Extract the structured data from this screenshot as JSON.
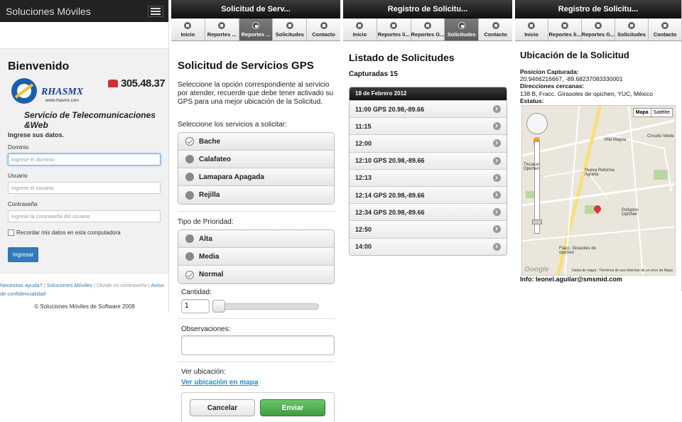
{
  "p1": {
    "brand": "Soluciones Móviles",
    "welcome": "Bienvenido",
    "logo_text": "RHASMX",
    "logo_url": "www.rhasmx.com",
    "phone": "305.48.37",
    "tagline": "Servicio de Telecomunicaciones &Web",
    "form_heading": "Ingrese sus datos.",
    "domain_label": "Dominio",
    "domain_placeholder": "ingrese el dominio",
    "user_label": "Usuario",
    "user_placeholder": "ingrese el usuario",
    "pass_label": "Contraseña",
    "pass_placeholder": "ingrese la contraseña del usuario",
    "remember": "Recordar mis datos en esta computadora",
    "submit": "Ingresar",
    "footer_links": [
      "Necesitas ayuda?",
      "Soluciones Móviles",
      "Olvide mi contraseña",
      "Aviso de confidencialidad"
    ],
    "copyright": "© Soluciones Móviles de Software 2008"
  },
  "p2": {
    "header": "Solicitud de Serv...",
    "tabs": [
      "Inicio",
      "Reportes ...",
      "Reportes ...",
      "Solicitudes",
      "Contacto"
    ],
    "title": "Solicitud de Servicios GPS",
    "description": "Seleccione la opción correspondiente al servicio por atender, recuerde que debe tener activado su GPS para una mejor ubicación de la Solicitud.",
    "services_label": "Seleccione los servicios a solicitar:",
    "services": [
      "Bache",
      "Calafateo",
      "Lamapara Apagada",
      "Rejilla"
    ],
    "priority_label": "Tipo de Prioridad:",
    "priorities": [
      "Alta",
      "Media",
      "Normal"
    ],
    "qty_label": "Cantidad:",
    "qty_value": "1",
    "obs_label": "Observaciones:",
    "loc_label": "Ver ubicación:",
    "loc_link": "Ver ubicación en mapa",
    "cancel": "Cancelar",
    "send": "Enviar"
  },
  "p3": {
    "header": "Registro de Solicitu...",
    "tabs": [
      "Inicio",
      "Reportes li...",
      "Reportes G...",
      "Solicitudes",
      "Contacto"
    ],
    "title": "Listado de Solicitudes",
    "subtitle": "Capturadas 15",
    "date": "18 de Febrero 2012",
    "items": [
      "11:00 GPS 20.98,-89.66",
      "11:15",
      "12:00",
      "12:10 GPS 20.98,-89.66",
      "12:13",
      "12:14 GPS 20.98,-89.66",
      "12:34 GPS 20.98,-89.66",
      "12:50",
      "14:00"
    ]
  },
  "p4": {
    "header": "Registro de Solicitu...",
    "tabs": [
      "Inicio",
      "Reportes li...",
      "Reportes G...",
      "Solicitudes",
      "Contacto"
    ],
    "title": "Ubicación de la Solicitud",
    "pos_label": "Posicion Capturada:",
    "pos_value": "20.9466216667, -89.68237083330001",
    "addr_label": "Direcciones cercanas:",
    "addr_value": "138 B, Fracc. Girasoles de opichen, YUC, México",
    "status_label": "Estatus:",
    "map_btn": "Mapa",
    "sat_btn": "Satélite",
    "map_labels": [
      "Villa Magna",
      "Nueva Reforma Agraria",
      "Polígono Opichen",
      "Fracc. Girasoles de opichen",
      "Circuito Verde",
      "Tixcacal Opichen"
    ],
    "google": "Google",
    "terms": "Datos de mapa - Términos de uso   Informar de un error de Maps",
    "info": "Info: leonel.aguilar@smsmid.com"
  }
}
